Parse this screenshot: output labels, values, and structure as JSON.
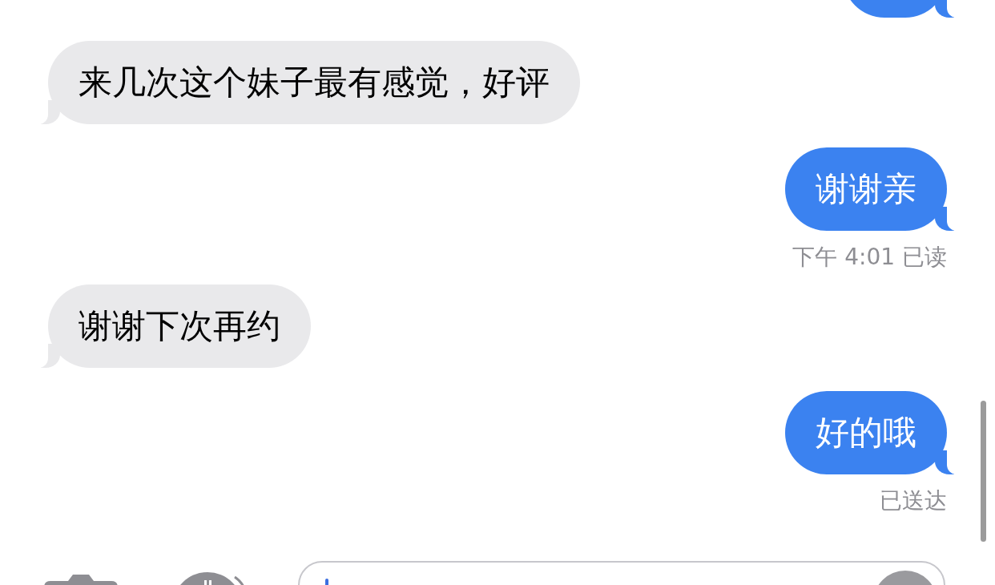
{
  "messages": [
    {
      "kind": "sent"
    },
    {
      "kind": "received",
      "text": "来几次这个妹子最有感觉，好评"
    },
    {
      "kind": "sent",
      "text": "谢谢亲"
    },
    {
      "kind": "status",
      "text": "下午 4:01 已读"
    },
    {
      "kind": "received",
      "text": "谢谢下次再约"
    },
    {
      "kind": "sent",
      "text": "好的哦"
    },
    {
      "kind": "status",
      "text": "已送达"
    }
  ]
}
